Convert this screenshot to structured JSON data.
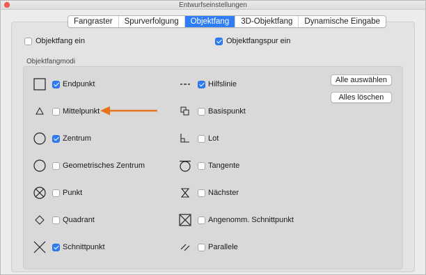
{
  "window": {
    "title": "Entwurfseinstellungen"
  },
  "tabs": [
    {
      "label": "Fangraster",
      "active": false
    },
    {
      "label": "Spurverfolgung",
      "active": false
    },
    {
      "label": "Objektfang",
      "active": true
    },
    {
      "label": "3D-Objektfang",
      "active": false
    },
    {
      "label": "Dynamische Eingabe",
      "active": false
    }
  ],
  "options": {
    "objektfang_ein": {
      "label": "Objektfang ein",
      "checked": false
    },
    "objektfangspur_ein": {
      "label": "Objektfangspur ein",
      "checked": true
    }
  },
  "modes_section_label": "Objektfangmodi",
  "modes_left": [
    {
      "label": "Endpunkt",
      "checked": true,
      "icon": "square-icon"
    },
    {
      "label": "Mittelpunkt",
      "checked": false,
      "icon": "triangle-icon"
    },
    {
      "label": "Zentrum",
      "checked": true,
      "icon": "circle-icon"
    },
    {
      "label": "Geometrisches Zentrum",
      "checked": false,
      "icon": "circle-icon"
    },
    {
      "label": "Punkt",
      "checked": false,
      "icon": "crossed-circle-icon"
    },
    {
      "label": "Quadrant",
      "checked": false,
      "icon": "diamond-icon"
    },
    {
      "label": "Schnittpunkt",
      "checked": true,
      "icon": "x-icon"
    }
  ],
  "modes_right": [
    {
      "label": "Hilfslinie",
      "checked": true,
      "icon": "dashed-line-icon"
    },
    {
      "label": "Basispunkt",
      "checked": false,
      "icon": "overlapping-squares-icon"
    },
    {
      "label": "Lot",
      "checked": false,
      "icon": "perpendicular-icon"
    },
    {
      "label": "Tangente",
      "checked": false,
      "icon": "tangent-circle-icon"
    },
    {
      "label": "Nächster",
      "checked": false,
      "icon": "hourglass-icon"
    },
    {
      "label": "Angenomm. Schnittpunkt",
      "checked": false,
      "icon": "boxed-x-icon"
    },
    {
      "label": "Parallele",
      "checked": false,
      "icon": "parallel-lines-icon"
    }
  ],
  "buttons": {
    "select_all": "Alle auswählen",
    "clear_all": "Alles löschen"
  },
  "colors": {
    "accent": "#2e7cf6",
    "arrow": "#e8731c"
  }
}
